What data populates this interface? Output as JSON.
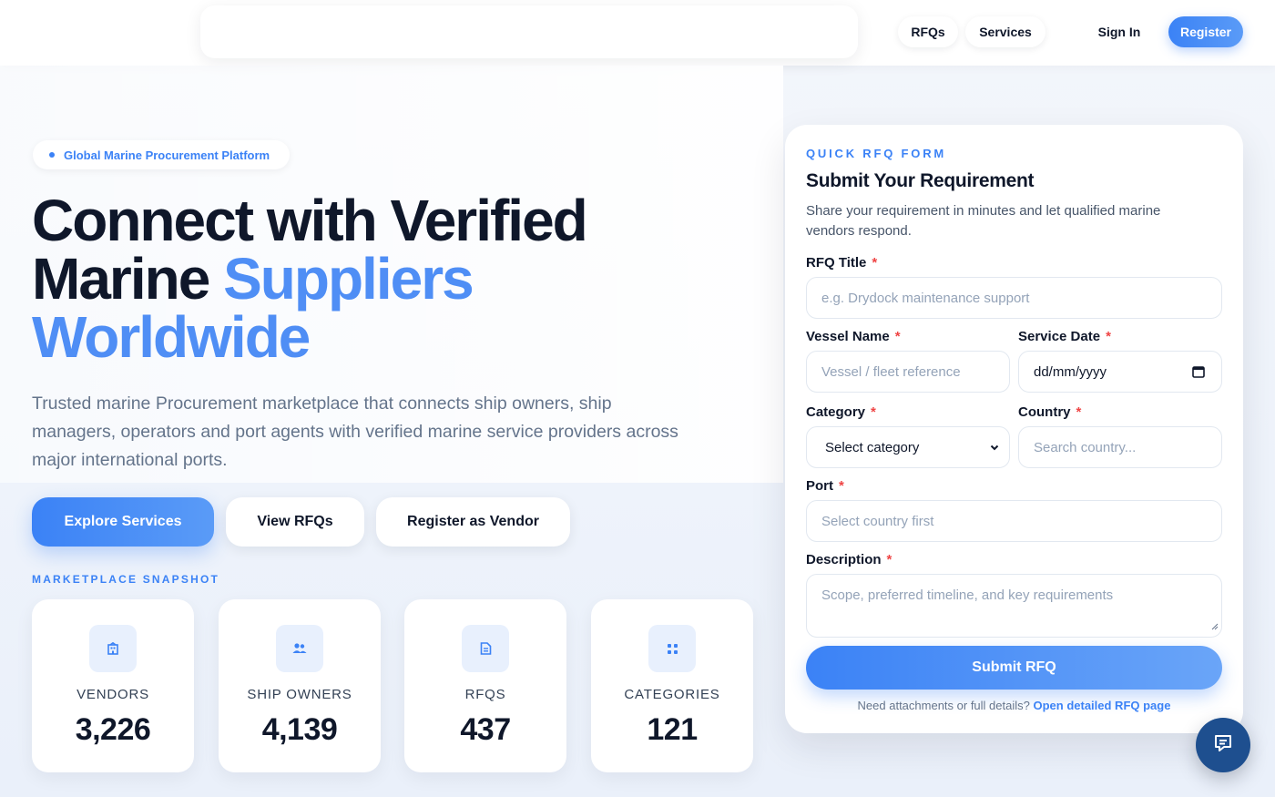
{
  "nav": {
    "links": [
      "RFQs",
      "Services"
    ],
    "sign_in": "Sign In",
    "register": "Register"
  },
  "hero": {
    "badge": "Global Marine Procurement Platform",
    "title_line1": "Connect with Verified",
    "title_line2_plain": "Marine ",
    "title_line2_accent": "Suppliers",
    "title_line3_accent": "Worldwide",
    "subtitle": "Trusted marine Procurement marketplace that connects ship owners, ship managers, operators and port agents with verified marine service providers across major international ports.",
    "buttons": {
      "explore": "Explore Services",
      "view_rfqs": "View RFQs",
      "register_vendor": "Register as Vendor"
    }
  },
  "snapshot": {
    "label": "MARKETPLACE SNAPSHOT",
    "stats": [
      {
        "label": "VENDORS",
        "value": "3,226",
        "icon": "building-icon"
      },
      {
        "label": "SHIP OWNERS",
        "value": "4,139",
        "icon": "users-icon"
      },
      {
        "label": "RFQS",
        "value": "437",
        "icon": "document-icon"
      },
      {
        "label": "CATEGORIES",
        "value": "121",
        "icon": "grid-icon"
      }
    ]
  },
  "form": {
    "kicker": "QUICK RFQ FORM",
    "title": "Submit Your Requirement",
    "description": "Share your requirement in minutes and let qualified marine vendors respond.",
    "required_mark": "*",
    "fields": {
      "rfq_title": {
        "label": "RFQ Title",
        "placeholder": "e.g. Drydock maintenance support"
      },
      "vessel": {
        "label": "Vessel Name",
        "placeholder": "Vessel / fleet reference"
      },
      "service_date": {
        "label": "Service Date",
        "value": "dd/mm/yyyy"
      },
      "category": {
        "label": "Category",
        "value": "Select category"
      },
      "country": {
        "label": "Country",
        "placeholder": "Search country..."
      },
      "port": {
        "label": "Port",
        "placeholder": "Select country first"
      },
      "description": {
        "label": "Description",
        "placeholder": "Scope, preferred timeline, and key requirements"
      }
    },
    "submit": "Submit RFQ",
    "footer_text": "Need attachments or full details?",
    "footer_link": "Open detailed RFQ page"
  },
  "colors": {
    "accent": "#3b82f6",
    "title": "#0f172a",
    "required": "#ef4444",
    "chat_button": "#1e4f8f"
  }
}
